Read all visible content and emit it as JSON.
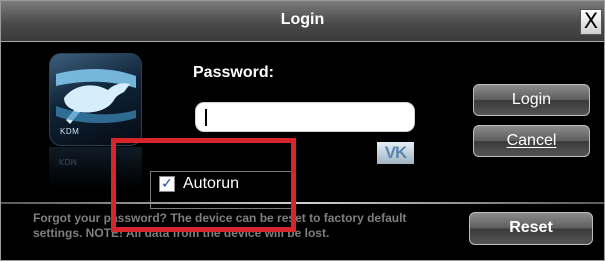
{
  "window": {
    "title": "Login",
    "close_label": "X"
  },
  "logo": {
    "label": "KDM",
    "icon": "kangaroo-logo-icon"
  },
  "form": {
    "password_label": "Password:",
    "password_value": "",
    "vk_label": "VK",
    "autorun_label": "Autorun",
    "autorun_checked": true
  },
  "buttons": {
    "login": "Login",
    "cancel": "Cancel",
    "reset": "Reset"
  },
  "footer": {
    "text": "Forgot your password? The device can be reset to factory default settings. NOTE! All data from the device will be lost."
  },
  "colors": {
    "highlight": "#d7262b",
    "background": "#000000"
  }
}
